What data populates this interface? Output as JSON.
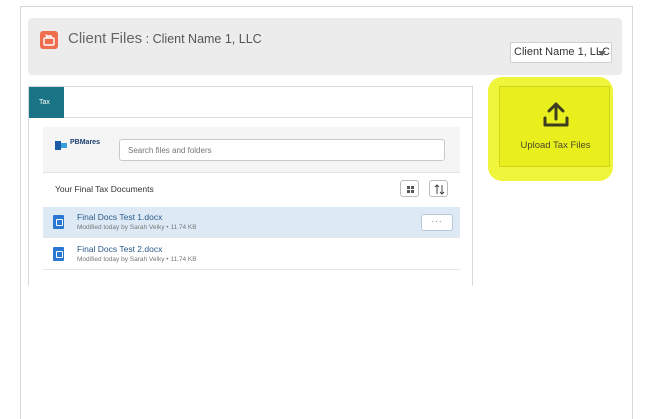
{
  "header": {
    "title": "Client Files",
    "separator": " : ",
    "client_name": "Client Name 1, LLC",
    "icon": "briefcase-icon"
  },
  "client_select": {
    "selected": "Client Name 1, LLC"
  },
  "tabs": [
    {
      "label": "Tax",
      "active": true
    }
  ],
  "search": {
    "logo_text": "PBMares",
    "placeholder": "Search files and folders"
  },
  "documents": {
    "title": "Your Final Tax Documents",
    "files": [
      {
        "name": "Final Docs Test 1.docx",
        "meta": "Modified today by Sarah Velky • 11.74 KB",
        "selected": true,
        "more_label": "···"
      },
      {
        "name": "Final Docs Test 2.docx",
        "meta": "Modified today by Sarah Velky • 11.74 KB",
        "selected": false
      }
    ]
  },
  "upload": {
    "label": "Upload Tax Files",
    "icon": "upload-icon"
  },
  "colors": {
    "tab_active": "#197585",
    "header_icon": "#ee6e4e",
    "highlight": "#e8ef1c",
    "selected_row": "#ddeaf6",
    "file_icon": "#2b78d2"
  }
}
